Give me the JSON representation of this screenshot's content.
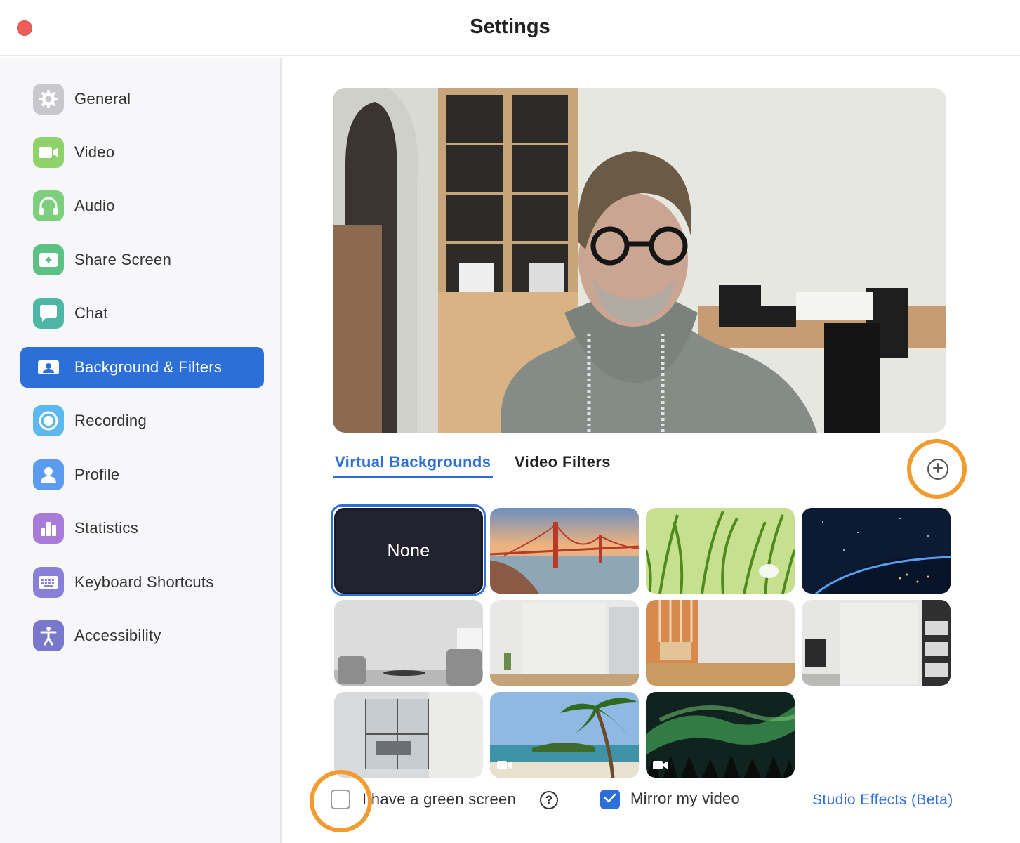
{
  "window": {
    "title": "Settings"
  },
  "colors": {
    "accent": "#2d6fd8",
    "highlight": "#f29b2e",
    "close": "#ec5f59"
  },
  "sidebar": {
    "items": [
      {
        "label": "General",
        "icon": "gear-icon",
        "color": "#c8c8cc",
        "active": false
      },
      {
        "label": "Video",
        "icon": "video-camera-icon",
        "color": "#8fd16a",
        "active": false
      },
      {
        "label": "Audio",
        "icon": "headphones-icon",
        "color": "#7ccf7c",
        "active": false
      },
      {
        "label": "Share Screen",
        "icon": "share-screen-icon",
        "color": "#5ec184",
        "active": false
      },
      {
        "label": "Chat",
        "icon": "chat-bubble-icon",
        "color": "#4fb6a6",
        "active": false
      },
      {
        "label": "Background & Filters",
        "icon": "portrait-icon",
        "color": "#2d6fd8",
        "active": true
      },
      {
        "label": "Recording",
        "icon": "record-icon",
        "color": "#5cb8ef",
        "active": false
      },
      {
        "label": "Profile",
        "icon": "person-icon",
        "color": "#5c9cef",
        "active": false
      },
      {
        "label": "Statistics",
        "icon": "bar-chart-icon",
        "color": "#a77bd8",
        "active": false
      },
      {
        "label": "Keyboard Shortcuts",
        "icon": "keyboard-icon",
        "color": "#8a7fd8",
        "active": false
      },
      {
        "label": "Accessibility",
        "icon": "accessibility-icon",
        "color": "#7a78cc",
        "active": false
      }
    ]
  },
  "main": {
    "tabs": [
      {
        "label": "Virtual Backgrounds",
        "active": true
      },
      {
        "label": "Video Filters",
        "active": false
      }
    ],
    "add_button_icon": "plus-circle-icon",
    "backgrounds": [
      {
        "label": "None",
        "kind": "none",
        "selected": true
      },
      {
        "kind": "golden-gate-bridge",
        "selected": false
      },
      {
        "kind": "grass",
        "selected": false
      },
      {
        "kind": "earth-from-space",
        "selected": false
      },
      {
        "kind": "living-room",
        "selected": false
      },
      {
        "kind": "white-office",
        "selected": false
      },
      {
        "kind": "wood-room",
        "selected": false
      },
      {
        "kind": "office-shelves",
        "selected": false
      },
      {
        "kind": "glass-office",
        "selected": false
      },
      {
        "kind": "beach-palm",
        "selected": false,
        "video": true
      },
      {
        "kind": "aurora",
        "selected": false,
        "video": true
      }
    ],
    "options": {
      "green_screen_label": "I have a green screen",
      "green_screen_checked": false,
      "help_glyph": "?",
      "mirror_label": "Mirror my video",
      "mirror_checked": true,
      "studio_effects_label": "Studio Effects (Beta)"
    }
  }
}
